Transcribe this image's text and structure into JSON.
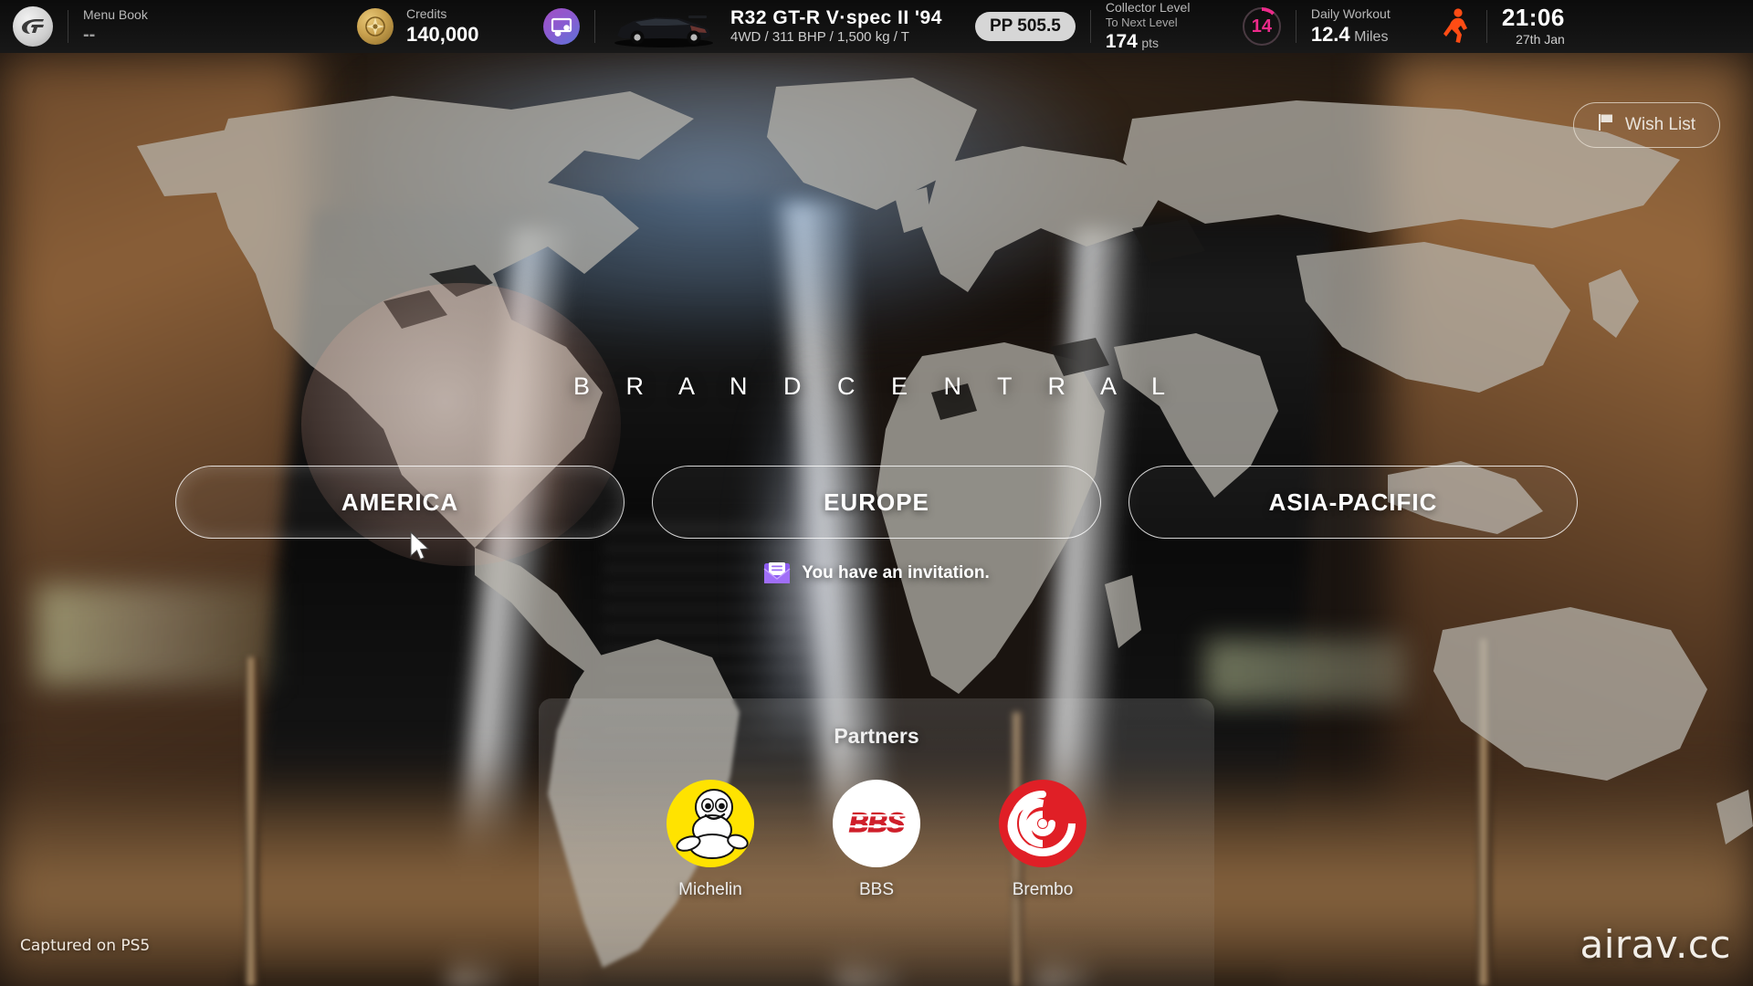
{
  "header": {
    "gt_logo_name": "gran-turismo-logo",
    "menu_book": {
      "label": "Menu Book",
      "value": "--"
    },
    "credits": {
      "label": "Credits",
      "value": "140,000",
      "icon": "credits-coin-icon"
    },
    "garage": {
      "icon": "garage-icon"
    },
    "car": {
      "thumb_icon": "car-thumbnail",
      "name": "R32 GT-R V·spec II '94",
      "specs": "4WD / 311 BHP / 1,500 kg / T"
    },
    "pp_badge": "PP 505.5",
    "collector": {
      "label": "Collector Level",
      "sub_label": "To Next Level",
      "points_value": "174",
      "points_unit": "pts",
      "level": "14",
      "ring_color": "#ec2a8a"
    },
    "workout": {
      "label": "Daily Workout",
      "value": "12.4",
      "unit": "Miles",
      "icon": "runner-icon",
      "icon_color": "#ff4c14"
    },
    "clock": {
      "time": "21:06",
      "date": "27th Jan"
    }
  },
  "wish_list": {
    "label": "Wish List",
    "icon": "flag-icon"
  },
  "page_title": "B R A N D   C E N T R A L",
  "regions": [
    {
      "label": "AMERICA",
      "selected": true
    },
    {
      "label": "EUROPE",
      "selected": false
    },
    {
      "label": "ASIA-PACIFIC",
      "selected": false
    }
  ],
  "invitation": {
    "text": "You have an invitation.",
    "icon": "envelope-icon"
  },
  "partners": {
    "title": "Partners",
    "items": [
      {
        "name": "Michelin",
        "logo": "michelin-logo",
        "bg_color": "#ffe300"
      },
      {
        "name": "BBS",
        "logo": "bbs-logo",
        "bg_color": "#ffffff"
      },
      {
        "name": "Brembo",
        "logo": "brembo-logo",
        "bg_color": "#e01f26"
      }
    ]
  },
  "footer": {
    "captured": "Captured on PS5",
    "watermark": "airav.cc"
  }
}
